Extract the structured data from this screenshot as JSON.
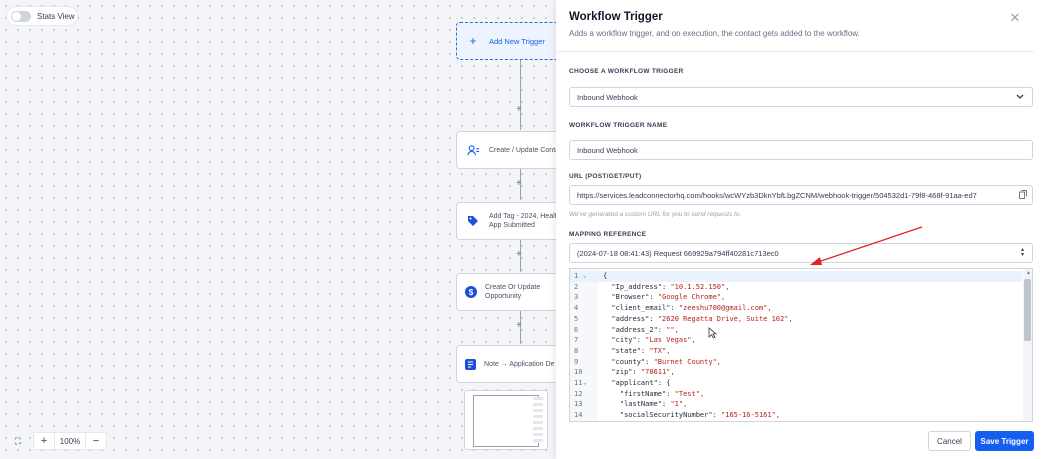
{
  "canvas": {
    "stats_view_label": "Stats View",
    "nodes": [
      {
        "label": "Add New Trigger"
      },
      {
        "label": "Create / Update Conta"
      },
      {
        "label_line1": "Add Tag - 2024, Healt",
        "label_line2": "App Submitted"
      },
      {
        "label_line1": "Create Or Update",
        "label_line2": "Opportunity"
      },
      {
        "label": "Note → Application De"
      }
    ],
    "zoom": {
      "level": "100%"
    }
  },
  "drawer": {
    "title": "Workflow Trigger",
    "subtitle": "Adds a workflow trigger, and on execution, the contact gets added to the workflow.",
    "choose_label": "CHOOSE A WORKFLOW TRIGGER",
    "choose_value": "Inbound Webhook",
    "name_label": "WORKFLOW TRIGGER NAME",
    "name_value": "Inbound Webhook",
    "url_label": "URL (POST/GET/PUT)",
    "url_value": "https://services.leadconnectorhq.com/hooks/wcWYzb3DknYbfLbgZCNM/webhook-trigger/504532d1-79f8-468f-91aa-ed7",
    "url_helper": "We've generated a custom URL for you to send requests to.",
    "mapping_label": "MAPPING REFERENCE",
    "mapping_value": "(2024-07-18 08:41:43) Request 669929a794ff40281c713ec0",
    "code_lines": [
      {
        "n": "1",
        "fold": "⌄",
        "key": "{",
        "val": ""
      },
      {
        "n": "2",
        "fold": "",
        "key": "  \"Ip_address\": ",
        "val": "\"10.1.52.150\","
      },
      {
        "n": "3",
        "fold": "",
        "key": "  \"Browser\": ",
        "val": "\"Google Chrome\","
      },
      {
        "n": "4",
        "fold": "",
        "key": "  \"client_email\": ",
        "val": "\"zeeshu700@gmail.com\","
      },
      {
        "n": "5",
        "fold": "",
        "key": "  \"address\": ",
        "val": "\"2620 Regatta Drive, Suite 102\","
      },
      {
        "n": "6",
        "fold": "",
        "key": "  \"address_2\": ",
        "val": "\"\","
      },
      {
        "n": "7",
        "fold": "",
        "key": "  \"city\": ",
        "val": "\"Las Vegas\","
      },
      {
        "n": "8",
        "fold": "",
        "key": "  \"state\": ",
        "val": "\"TX\","
      },
      {
        "n": "9",
        "fold": "",
        "key": "  \"county\": ",
        "val": "\"Burnet County\","
      },
      {
        "n": "10",
        "fold": "",
        "key": "  \"zip\": ",
        "val": "\"78611\","
      },
      {
        "n": "11",
        "fold": "⌄",
        "key": "  \"applicant\": {",
        "val": ""
      },
      {
        "n": "12",
        "fold": "",
        "key": "    \"firstName\": ",
        "val": "\"Test\","
      },
      {
        "n": "13",
        "fold": "",
        "key": "    \"lastName\": ",
        "val": "\"1\","
      },
      {
        "n": "14",
        "fold": "",
        "key": "    \"socialSecurityNumber\": ",
        "val": "\"165-16-5161\","
      }
    ],
    "cancel_label": "Cancel",
    "save_label": "Save Trigger"
  },
  "colors": {
    "primary": "#155eef",
    "annotation_arrow": "#e02424"
  }
}
